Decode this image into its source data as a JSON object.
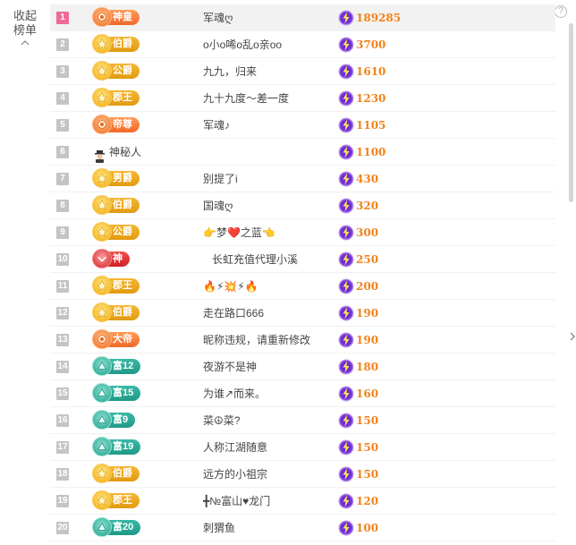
{
  "collapse": {
    "label_line1": "收起",
    "label_line2": "榜单"
  },
  "accent": {
    "value_color": "#f2821b",
    "rank1_color": "#f0689a",
    "bolt_color": "#7b3bd6"
  },
  "rows": [
    {
      "rank": "1",
      "badge": "神皇",
      "badge_style": "orange",
      "name": "军魂ღ",
      "value": "189285"
    },
    {
      "rank": "2",
      "badge": "伯爵",
      "badge_style": "gold",
      "name": "o小o唏o乱o亲oo",
      "value": "3700"
    },
    {
      "rank": "3",
      "badge": "公爵",
      "badge_style": "gold",
      "name": "九九，归来",
      "value": "1610"
    },
    {
      "rank": "4",
      "badge": "郡王",
      "badge_style": "gold",
      "name": "九十九度～差一度",
      "value": "1230"
    },
    {
      "rank": "5",
      "badge": "帝尊",
      "badge_style": "orange",
      "name": "军魂♪",
      "value": "1105"
    },
    {
      "rank": "6",
      "badge": "",
      "badge_style": "plain",
      "name": "神秘人",
      "value": "1100"
    },
    {
      "rank": "7",
      "badge": "男爵",
      "badge_style": "gold",
      "name": "别提了i",
      "value": "430"
    },
    {
      "rank": "8",
      "badge": "伯爵",
      "badge_style": "gold",
      "name": "国魂ღ",
      "value": "320"
    },
    {
      "rank": "9",
      "badge": "公爵",
      "badge_style": "gold",
      "name": "👉梦❤️之蓝👈",
      "value": "300"
    },
    {
      "rank": "10",
      "badge": "神",
      "badge_style": "red",
      "name": "长虹充值代理小溪",
      "value": "250"
    },
    {
      "rank": "11",
      "badge": "郡王",
      "badge_style": "gold",
      "name": "🔥⚡💥⚡🔥",
      "value": "200"
    },
    {
      "rank": "12",
      "badge": "伯爵",
      "badge_style": "gold",
      "name": "走在路口666",
      "value": "190"
    },
    {
      "rank": "13",
      "badge": "大帝",
      "badge_style": "orange",
      "name": "昵称违规，请重新修改",
      "value": "190"
    },
    {
      "rank": "14",
      "badge": "富12",
      "badge_style": "teal",
      "name": "夜游不是神",
      "value": "180"
    },
    {
      "rank": "15",
      "badge": "富15",
      "badge_style": "teal",
      "name": "为谁↗而来。",
      "value": "160"
    },
    {
      "rank": "16",
      "badge": "富9",
      "badge_style": "teal",
      "name": "菜☮菜?",
      "value": "150"
    },
    {
      "rank": "17",
      "badge": "富19",
      "badge_style": "teal",
      "name": "人称江湖随意",
      "value": "150"
    },
    {
      "rank": "18",
      "badge": "伯爵",
      "badge_style": "gold",
      "name": "远方的小祖宗",
      "value": "150"
    },
    {
      "rank": "19",
      "badge": "郡王",
      "badge_style": "gold",
      "name": "╋№富山♥龙门",
      "value": "120"
    },
    {
      "rank": "20",
      "badge": "富20",
      "badge_style": "teal",
      "name": "刺猬鱼",
      "value": "100"
    }
  ]
}
